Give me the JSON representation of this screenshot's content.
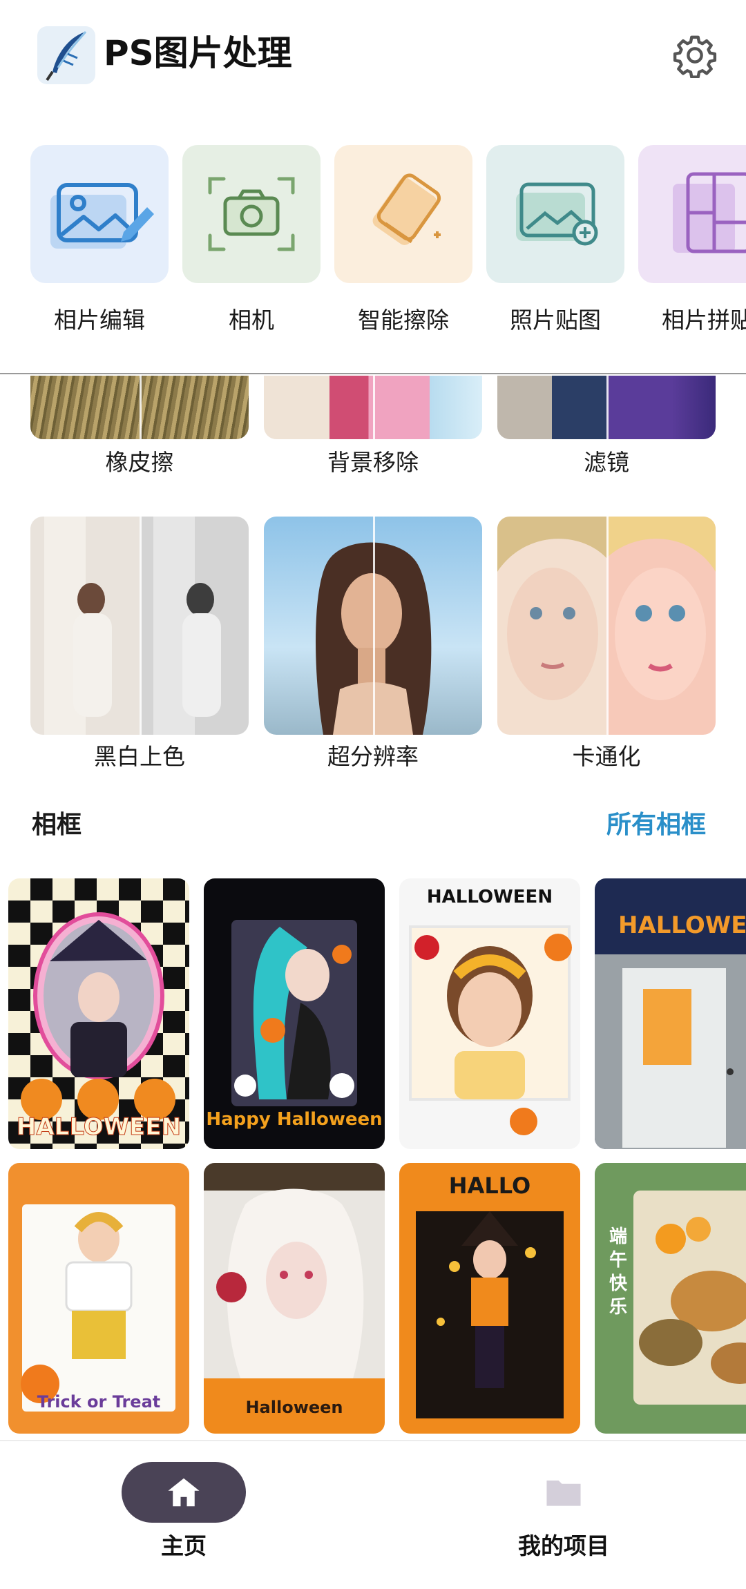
{
  "app": {
    "title": "PS图片处理",
    "logo_icon": "feather-logo-icon",
    "settings_icon": "gear-icon"
  },
  "tools": [
    {
      "label": "相片编辑",
      "icon": "photo-edit-icon",
      "bg": "#e5eefb",
      "color": "#3b8fd8"
    },
    {
      "label": "相机",
      "icon": "camera-icon",
      "bg": "#e6efe4",
      "color": "#7aa56e"
    },
    {
      "label": "智能擦除",
      "icon": "eraser-icon",
      "bg": "#fbeedd",
      "color": "#e2a75c"
    },
    {
      "label": "照片贴图",
      "icon": "photo-sticker-icon",
      "bg": "#e1eeee",
      "color": "#3f8a8a"
    },
    {
      "label": "相片拼贴",
      "icon": "collage-icon",
      "bg": "#efe3f6",
      "color": "#9a62c0"
    }
  ],
  "features": [
    {
      "label": "橡皮擦"
    },
    {
      "label": "背景移除"
    },
    {
      "label": "滤镜"
    },
    {
      "label": "黑白上色"
    },
    {
      "label": "超分辨率"
    },
    {
      "label": "卡通化"
    }
  ],
  "frames_section": {
    "title": "相框",
    "see_all": "所有相框",
    "row1": [
      {
        "caption": "HALLOWEEN"
      },
      {
        "caption": "Happy Halloween"
      },
      {
        "caption": "HALLOWEEN"
      },
      {
        "caption": "HALLOWEEN"
      }
    ],
    "row2": [
      {
        "caption": "Trick or Treat"
      },
      {
        "caption": "Halloween"
      },
      {
        "caption": "HALLO"
      },
      {
        "caption": "端午快乐"
      }
    ]
  },
  "bottom_nav": [
    {
      "label": "主页",
      "icon": "home-icon",
      "active": true
    },
    {
      "label": "我的项目",
      "icon": "folder-icon",
      "active": false
    }
  ],
  "colors": {
    "accent_link": "#2a8fc9",
    "nav_active": "#4a4356"
  }
}
